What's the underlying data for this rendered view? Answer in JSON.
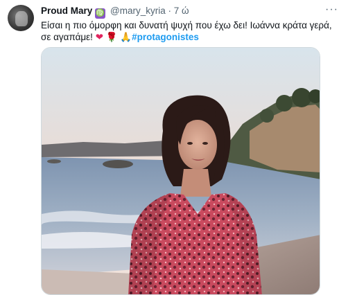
{
  "tweet": {
    "display_name": "Proud Mary",
    "zodiac_glyph": "♍",
    "handle": "@mary_kyria",
    "separator": "·",
    "time": "7 ώ",
    "more_glyph": "···",
    "text_main": "Είσαι η πιο όμορφη και δυνατή ψυχή που έχω δει! Ιωάννα κράτα γερά, σε αγαπάμε!",
    "emoji_heart": "❤",
    "emoji_rose": "🌹",
    "emoji_pray": "🙏",
    "hashtag": "#protagonistes"
  },
  "icons": {
    "avatar": "profile-avatar",
    "zodiac": "virgo-icon",
    "more": "more-options-icon"
  },
  "colors": {
    "link": "#1d9bf0",
    "secondary_text": "#536471",
    "zodiac_badge": "#8a56c9",
    "dress": "#c94a5e"
  }
}
